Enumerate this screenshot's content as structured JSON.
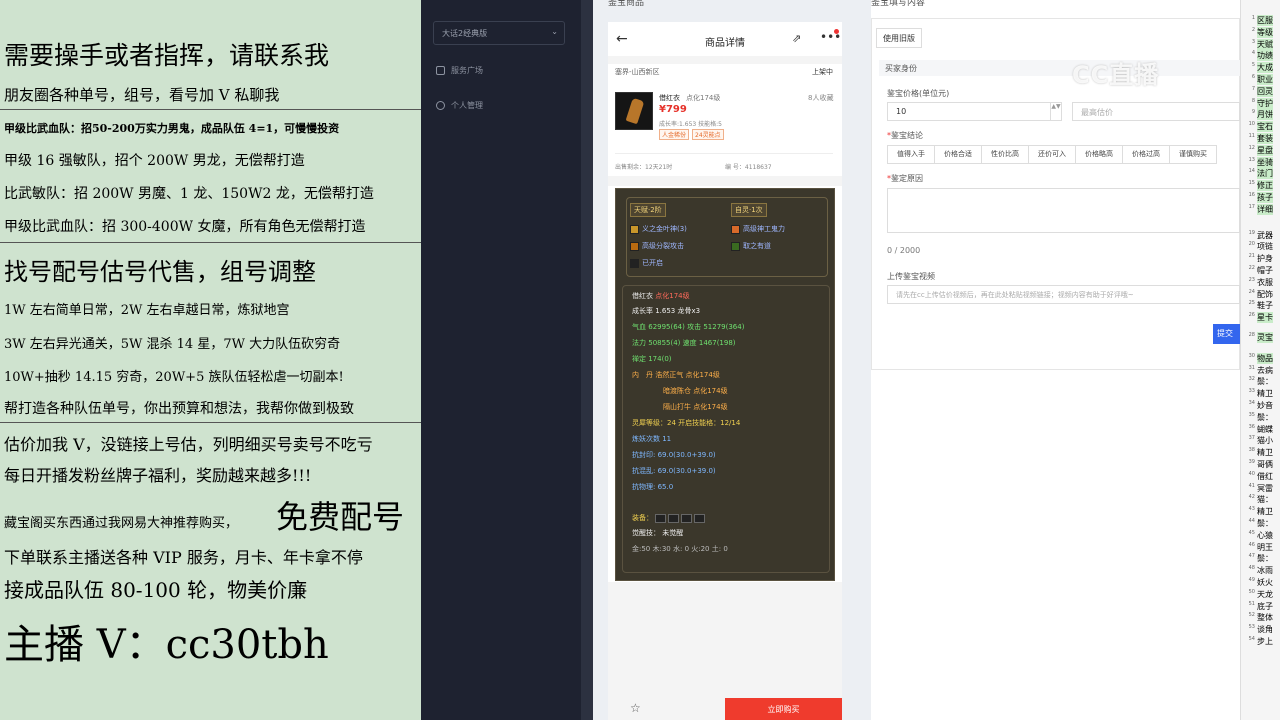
{
  "left_panel": {
    "l1": "需要操手或者指挥，请联系我",
    "l2": "朋友圈各种单号，组号，看号加 V 私聊我",
    "l3": "甲级比武血队：招50-200万实力男鬼，成品队伍 4=1，可慢慢投资",
    "l4": "甲级 16 强敏队，招个 200W 男龙，无偿帮打造",
    "l5": "比武敏队：招 200W 男魔、1 龙、150W2 龙，无偿帮打造",
    "l6": "甲级比武血队：招 300-400W 女魔，所有角色无偿帮打造",
    "l7": "找号配号估号代售，组号调整",
    "l8": "1W 左右简单日常，2W 左右卓越日常，炼狱地宫",
    "l9": "3W 左右异光通关，5W 混杀 14 星，7W 大力队伍砍穷奇",
    "l10": "10W+抽秒 14.15 穷奇，20W+5 族队伍轻松虐一切副本!",
    "l11": "帮打造各种队伍单号，你出预算和想法，我帮你做到极致",
    "l12": "估价加我 V，没链接上号估，列明细买号卖号不吃亏",
    "l13": "每日开播发粉丝牌子福利，奖励越来越多!!!",
    "l14a": "藏宝阁买东西通过我网易大神推荐购买，",
    "l14b": "免费配号",
    "l15": "下单联系主播送各种 VIP 服务，月卡、年卡拿不停",
    "l16": "接成品队伍 80-100 轮，物美价廉",
    "l17": "主播 V：cc30tbh"
  },
  "sidebar": {
    "dropdown": "大话2经典版",
    "chevron": "⌄",
    "items": [
      {
        "label": "服务广场"
      },
      {
        "label": "个人管理"
      }
    ]
  },
  "middle": {
    "section_title": "鉴宝商品",
    "header_title": "商品详情",
    "back": "←",
    "share": "⇗",
    "more": "•••",
    "server": "塞界-山西新区",
    "status": "上架中",
    "product_name": "借红衣",
    "product_sub": "点化174级",
    "price": "¥799",
    "stats": "成长率:1.653 技能格:5",
    "tags": [
      "人金稀份",
      "24灵能点"
    ],
    "fav": "8人收藏",
    "sold_label": "出售剩余：12天21时",
    "id_label": "编 号：4118637",
    "card": {
      "badge1": "天赋·2阶",
      "badge2": "自灵·1次",
      "skills": [
        "义之金叶神(3)",
        "高级神工鬼力",
        "高级分裂攻击",
        "取之有道",
        "已开启"
      ],
      "name": "借红衣",
      "name_sub": "点化174级",
      "growth": "成长率 1.653 龙骨x3",
      "hp_label": "气血",
      "hp": "62995(64)",
      "atk_label": "攻击",
      "atk": "51279(364)",
      "mp_label": "法力",
      "mp": "50855(4)",
      "spd_label": "速度",
      "spd": "1467(198)",
      "ding": "禅定 174(0)",
      "dan1_label": "内　丹",
      "dan1": "浩然正气 点化174级",
      "dan2": "暗渡陈仓 点化174级",
      "dan3": "隔山打牛 点化174级",
      "spirit": "灵犀等级：24 开启技能格：12/14",
      "refine": "炼妖次数 11",
      "res1": "抗封印: 69.0(30.0+39.0)",
      "res2": "抗混乱: 69.0(30.0+39.0)",
      "res3": "抗物理: 65.0",
      "equip_label": "装备：",
      "awake": "觉醒技：  未觉醒",
      "elements": "金:50 木:30 水: 0 火:20 土: 0"
    },
    "star": "☆",
    "fav_short": "收藏",
    "buy": "立即购买"
  },
  "form": {
    "section_title": "鉴宝填写内容",
    "tab": "使用旧版",
    "buyer": "买家身份",
    "price_label": "鉴宝价格(单位元)",
    "price_value": "10",
    "stepper": "▲▼",
    "max_placeholder": "最高估价",
    "conclusion_label": "鉴宝结论",
    "options": [
      "值得入手",
      "价格合适",
      "性价比高",
      "还价可入",
      "价格略高",
      "价格过高",
      "谨慎购买"
    ],
    "reason_label": "鉴定原因",
    "count": "0 / 2000",
    "video_label": "上传鉴宝视频",
    "video_placeholder": "请先在cc上传估价视频后，再在此处粘贴视频链接；视频内容有助于好评哦~",
    "submit": "提交"
  },
  "watermark": "CC直播",
  "right_list": [
    {
      "n": "1",
      "t": "区服",
      "g": true
    },
    {
      "n": "2",
      "t": "等级",
      "g": true
    },
    {
      "n": "3",
      "t": "天赋",
      "g": true
    },
    {
      "n": "4",
      "t": "功绩",
      "g": true
    },
    {
      "n": "5",
      "t": "大成",
      "g": true
    },
    {
      "n": "6",
      "t": "职业",
      "g": true
    },
    {
      "n": "7",
      "t": "回灵",
      "g": true
    },
    {
      "n": "8",
      "t": "守护",
      "g": true
    },
    {
      "n": "9",
      "t": "月饼",
      "g": true
    },
    {
      "n": "10",
      "t": "宝石",
      "g": true
    },
    {
      "n": "11",
      "t": "套装",
      "g": true
    },
    {
      "n": "12",
      "t": "星盘",
      "g": true
    },
    {
      "n": "13",
      "t": "坐骑",
      "g": true
    },
    {
      "n": "14",
      "t": "法门",
      "g": true
    },
    {
      "n": "15",
      "t": "修正",
      "g": true
    },
    {
      "n": "16",
      "t": "孩子",
      "g": true
    },
    {
      "n": "17",
      "t": "详细",
      "g": true
    },
    {
      "n": "19",
      "t": "武器",
      "g": false
    },
    {
      "n": "20",
      "t": "项链",
      "g": false
    },
    {
      "n": "21",
      "t": "护身",
      "g": false
    },
    {
      "n": "22",
      "t": "帽子",
      "g": false
    },
    {
      "n": "23",
      "t": "衣服",
      "g": false
    },
    {
      "n": "24",
      "t": "配饰",
      "g": false
    },
    {
      "n": "25",
      "t": "鞋子",
      "g": false
    },
    {
      "n": "26",
      "t": "星卡",
      "g": true
    },
    {
      "n": "28",
      "t": "灵宝",
      "g": true
    },
    {
      "n": "30",
      "t": "物品",
      "g": true
    },
    {
      "n": "31",
      "t": "去病",
      "g": false
    },
    {
      "n": "32",
      "t": "鬃：",
      "g": false
    },
    {
      "n": "33",
      "t": "精卫",
      "g": false
    },
    {
      "n": "34",
      "t": "妙音",
      "g": false
    },
    {
      "n": "35",
      "t": "鬃：",
      "g": false
    },
    {
      "n": "36",
      "t": "蝴蝶",
      "g": false
    },
    {
      "n": "37",
      "t": "猫小",
      "g": false
    },
    {
      "n": "38",
      "t": "精卫",
      "g": false
    },
    {
      "n": "39",
      "t": "哥俩",
      "g": false
    },
    {
      "n": "40",
      "t": "借红",
      "g": false
    },
    {
      "n": "41",
      "t": "冥雷",
      "g": false
    },
    {
      "n": "42",
      "t": "猫：",
      "g": false
    },
    {
      "n": "43",
      "t": "精卫",
      "g": false
    },
    {
      "n": "44",
      "t": "鬃：",
      "g": false
    },
    {
      "n": "45",
      "t": "心猿",
      "g": false
    },
    {
      "n": "46",
      "t": "明王",
      "g": false
    },
    {
      "n": "47",
      "t": "鬃：",
      "g": false
    },
    {
      "n": "48",
      "t": "冰雨",
      "g": false
    },
    {
      "n": "49",
      "t": "妖火",
      "g": false
    },
    {
      "n": "50",
      "t": "天龙",
      "g": false
    },
    {
      "n": "51",
      "t": "底子",
      "g": false
    },
    {
      "n": "52",
      "t": "整体",
      "g": false
    },
    {
      "n": "53",
      "t": "谈角",
      "g": false
    },
    {
      "n": "54",
      "t": "步上",
      "g": false
    }
  ]
}
